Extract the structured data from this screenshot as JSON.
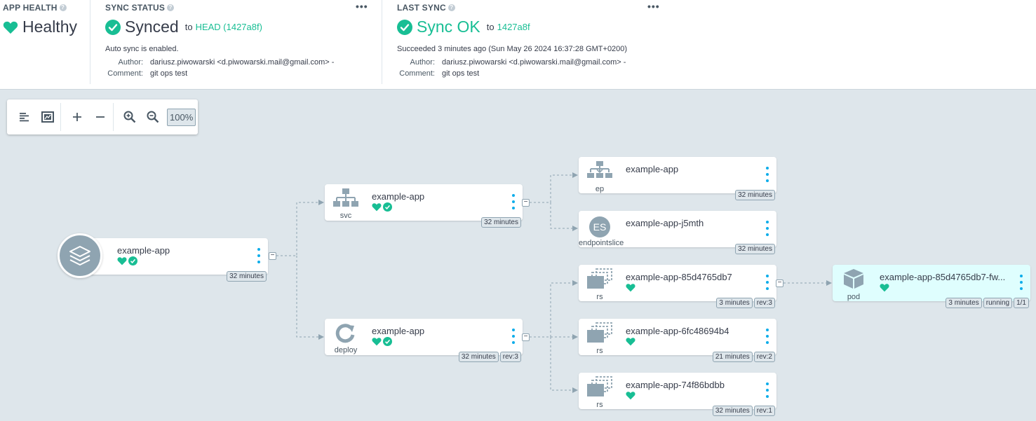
{
  "header": {
    "app_health": {
      "title": "APP HEALTH",
      "help": "?",
      "value": "Healthy"
    },
    "sync_status": {
      "title": "SYNC STATUS",
      "help": "?",
      "menu": "•••",
      "value": "Synced",
      "to_text": "to",
      "revision": "HEAD (1427a8f)",
      "auto_sync": "Auto sync is enabled.",
      "author_label": "Author:",
      "author": "dariusz.piwowarski <d.piwowarski.mail@gmail.com> -",
      "comment_label": "Comment:",
      "comment": "git ops test"
    },
    "last_sync": {
      "title": "LAST SYNC",
      "help": "?",
      "menu": "•••",
      "value": "Sync OK",
      "to_text": "to",
      "revision": "1427a8f",
      "succeeded": "Succeeded 3 minutes ago (Sun May 26 2024 16:37:28 GMT+0200)",
      "author_label": "Author:",
      "author": "dariusz.piwowarski <d.piwowarski.mail@gmail.com> -",
      "comment_label": "Comment:",
      "comment": "git ops test"
    }
  },
  "toolbar": {
    "zoom": "100%",
    "icons": [
      "list-view-icon",
      "fit-screen-icon",
      "expand-icon",
      "collapse-icon",
      "zoom-in-icon",
      "zoom-out-icon"
    ]
  },
  "nodes": {
    "app": {
      "name": "example-app",
      "age": "32 minutes"
    },
    "svc": {
      "name": "example-app",
      "kind": "svc",
      "age": "32 minutes"
    },
    "deploy": {
      "name": "example-app",
      "kind": "deploy",
      "age": "32 minutes",
      "rev": "rev:3"
    },
    "ep": {
      "name": "example-app",
      "kind": "ep",
      "age": "32 minutes"
    },
    "endpointslice": {
      "name": "example-app-j5mth",
      "kind": "endpointslice",
      "badge": "ES",
      "age": "32 minutes"
    },
    "rs1": {
      "name": "example-app-85d4765db7",
      "kind": "rs",
      "age": "3 minutes",
      "rev": "rev:3"
    },
    "rs2": {
      "name": "example-app-6fc48694b4",
      "kind": "rs",
      "age": "21 minutes",
      "rev": "rev:2"
    },
    "rs3": {
      "name": "example-app-74f86bdbb",
      "kind": "rs",
      "age": "32 minutes",
      "rev": "rev:1"
    },
    "pod": {
      "name": "example-app-85d4765db7-fw...",
      "kind": "pod",
      "age": "3 minutes",
      "state": "running",
      "ready": "1/1"
    }
  },
  "collapse_symbol": "−",
  "colors": {
    "healthy": "#18be94",
    "icon_gray": "#8fa4b1",
    "menu_blue": "#0dadea",
    "canvas": "#dee6eb",
    "pod_bg": "#dffefe"
  }
}
